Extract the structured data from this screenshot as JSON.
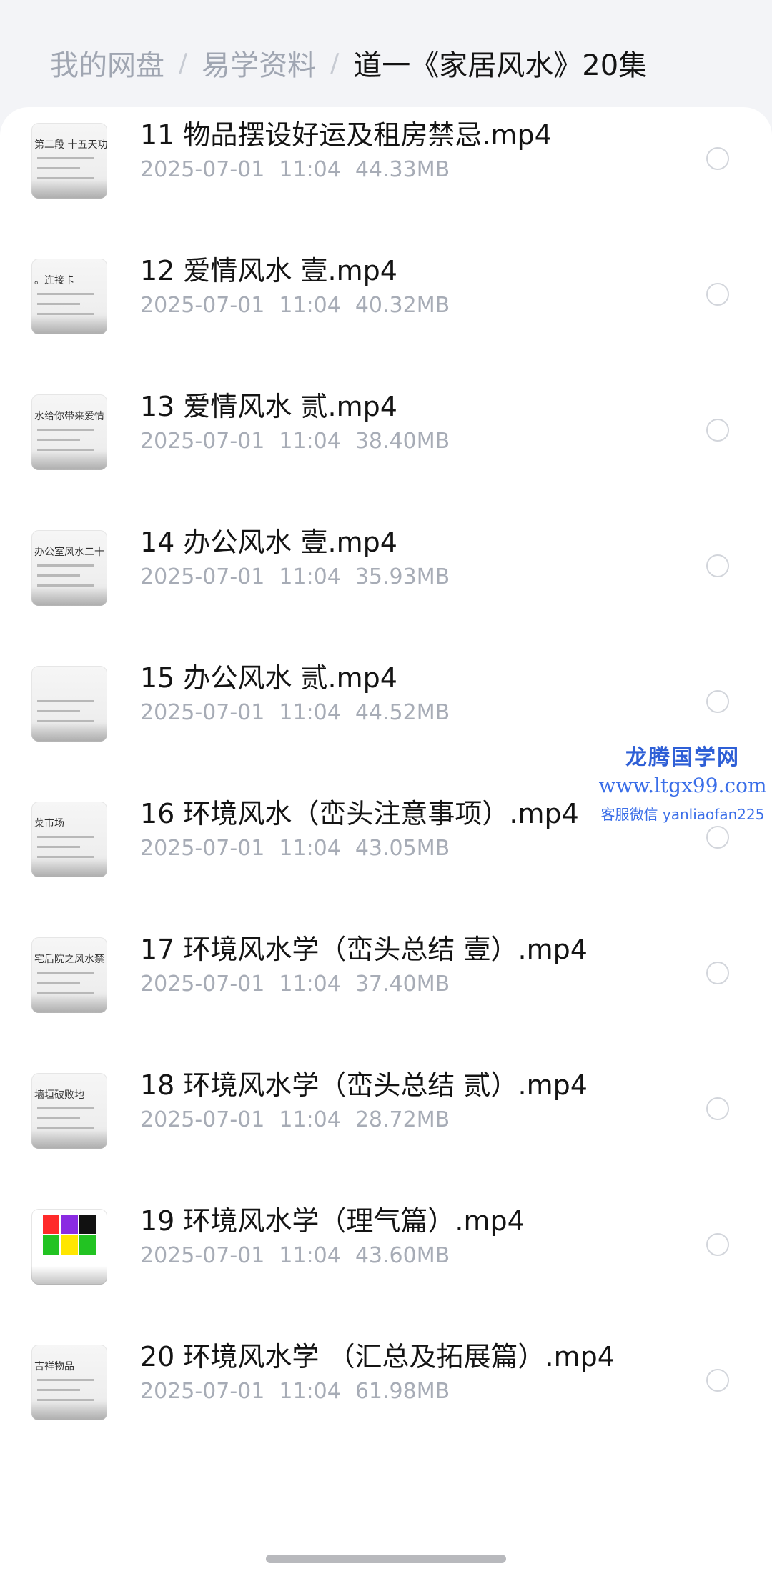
{
  "breadcrumb": {
    "root": "我的网盘",
    "level1": "易学资料",
    "current": "道一《家居风水》20集",
    "separator": "/"
  },
  "files": [
    {
      "name": "11 物品摆设好运及租房禁忌.mp4",
      "date": "2025-07-01",
      "time": "11:04",
      "size": "44.33MB",
      "thumb_text": "第二段 十五天功能"
    },
    {
      "name": "12 爱情风水 壹.mp4",
      "date": "2025-07-01",
      "time": "11:04",
      "size": "40.32MB",
      "thumb_text": "。连接卡"
    },
    {
      "name": "13 爱情风水 贰.mp4",
      "date": "2025-07-01",
      "time": "11:04",
      "size": "38.40MB",
      "thumb_text": "水给你带来爱情"
    },
    {
      "name": "14 办公风水 壹.mp4",
      "date": "2025-07-01",
      "time": "11:04",
      "size": "35.93MB",
      "thumb_text": "办公室风水二十"
    },
    {
      "name": "15 办公风水 贰.mp4",
      "date": "2025-07-01",
      "time": "11:04",
      "size": "44.52MB",
      "thumb_text": ""
    },
    {
      "name": "16 环境风水（峦头注意事项）.mp4",
      "date": "2025-07-01",
      "time": "11:04",
      "size": "43.05MB",
      "thumb_text": "菜市场"
    },
    {
      "name": "17 环境风水学（峦头总结 壹）.mp4",
      "date": "2025-07-01",
      "time": "11:04",
      "size": "37.40MB",
      "thumb_text": "宅后院之风水禁"
    },
    {
      "name": "18 环境风水学（峦头总结 贰）.mp4",
      "date": "2025-07-01",
      "time": "11:04",
      "size": "28.72MB",
      "thumb_text": "墙垣破败地"
    },
    {
      "name": "19 环境风水学（理气篇）.mp4",
      "date": "2025-07-01",
      "time": "11:04",
      "size": "43.60MB",
      "thumb_text": ""
    },
    {
      "name": "20 环境风水学 （汇总及拓展篇）.mp4",
      "date": "2025-07-01",
      "time": "11:04",
      "size": "61.98MB",
      "thumb_text": "吉祥物品"
    }
  ],
  "watermark": {
    "name": "龙腾国学网",
    "url": "www.ltgx99.com",
    "contact": "客服微信 yanliaofan225"
  },
  "colors": {
    "grid": [
      "#ff2a2a",
      "#8a2be2",
      "#111111",
      "#22c322",
      "#ffe600",
      "#22c322"
    ]
  }
}
